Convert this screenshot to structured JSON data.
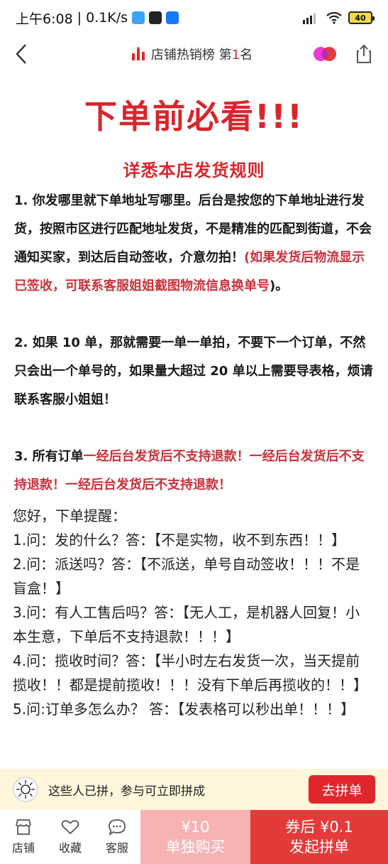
{
  "status": {
    "time": "上午6:08",
    "speed": "0.1K/s",
    "battery": "40"
  },
  "nav": {
    "title_prefix": "店铺热销榜 第",
    "rank": "1",
    "title_suffix": "名"
  },
  "notice": {
    "title": "下单前必看!!!",
    "subtitle": "详悉本店发货规则",
    "rule1_text": "1. 你发哪里就下单地址写哪里。后台是按您的下单地址进行发货，按照市区进行匹配地址发货，不是精准的匹配到街道，不会通知买家，到达后自动签收，介意勿拍！",
    "rule1_red": "(如果发货后物流显示已签收，可联系客服姐姐截图物流信息换单号",
    "rule1_end": ")。",
    "rule2_text": "2. 如果 10 单，那就需要一单一单拍，不要下一个订单，不然只会出一个单号的，如果量大超过 20 单以上需要导表格，烦请联系客服小姐姐！",
    "rule3_text": "3. 所有订单",
    "rule3_red": "一经后台发货后不支持退款！一经后台发货后不支持退款！一经后台发货后不支持退款！"
  },
  "faq": {
    "intro": "您好，下单提醒：",
    "q1": "1.问：发的什么？答：【不是实物，收不到东西！！】",
    "q2": "2.问：派送吗？答：【不派送，单号自动签收！！！不是盲盒！】",
    "q3": "3.问：有人工售后吗？答：【无人工，是机器人回复！小本生意，下单后不支持退款！！！】",
    "q4": "4.问：揽收时间？答：【半小时左右发货一次，当天提前揽收！！都是提前揽收！！！没有下单后再揽收的！！】",
    "q5": "5.问:订单多怎么办？ 答：【发表格可以秒出单！！！】"
  },
  "group": {
    "text": "这些人已拼，参与可立即拼成",
    "button": "去拼单"
  },
  "bottom": {
    "tab_shop": "店铺",
    "tab_fav": "收藏",
    "tab_service": "客服",
    "single_price": "¥10",
    "single_label": "单独购买",
    "group_price": "券后 ¥0.1",
    "group_label": "发起拼单"
  },
  "colors": {
    "accent_red": "#e0262c",
    "soft_pink": "#f7b3b3",
    "notice_bg": "#fff6dc"
  }
}
